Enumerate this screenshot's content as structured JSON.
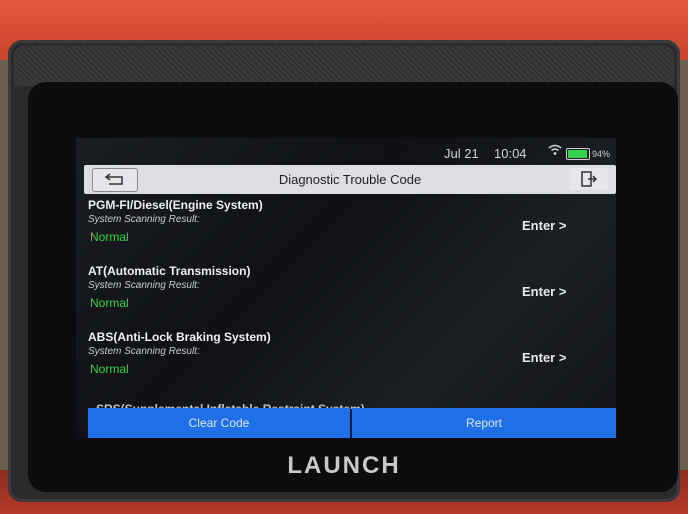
{
  "status_bar": {
    "date": "Jul 21",
    "time": "10:04",
    "battery_pct": "94%",
    "battery_level": 0.94
  },
  "header": {
    "title": "Diagnostic Trouble Code"
  },
  "systems": [
    {
      "name": "PGM-FI/Diesel(Engine System)",
      "label": "System Scanning Result:",
      "status": "Normal",
      "action": "Enter >"
    },
    {
      "name": "AT(Automatic Transmission)",
      "label": "System Scanning Result:",
      "status": "Normal",
      "action": "Enter >"
    },
    {
      "name": "ABS(Anti-Lock Braking System)",
      "label": "System Scanning Result:",
      "status": "Normal",
      "action": "Enter >"
    }
  ],
  "partial_row": "SRS(Supplemental Inflatable Restraint System)",
  "footer": {
    "clear_label": "Clear Code",
    "report_label": "Report"
  },
  "device_logo": "LAUNCH",
  "colors": {
    "accent": "#1f6fe6",
    "status_ok": "#3fd04c"
  }
}
